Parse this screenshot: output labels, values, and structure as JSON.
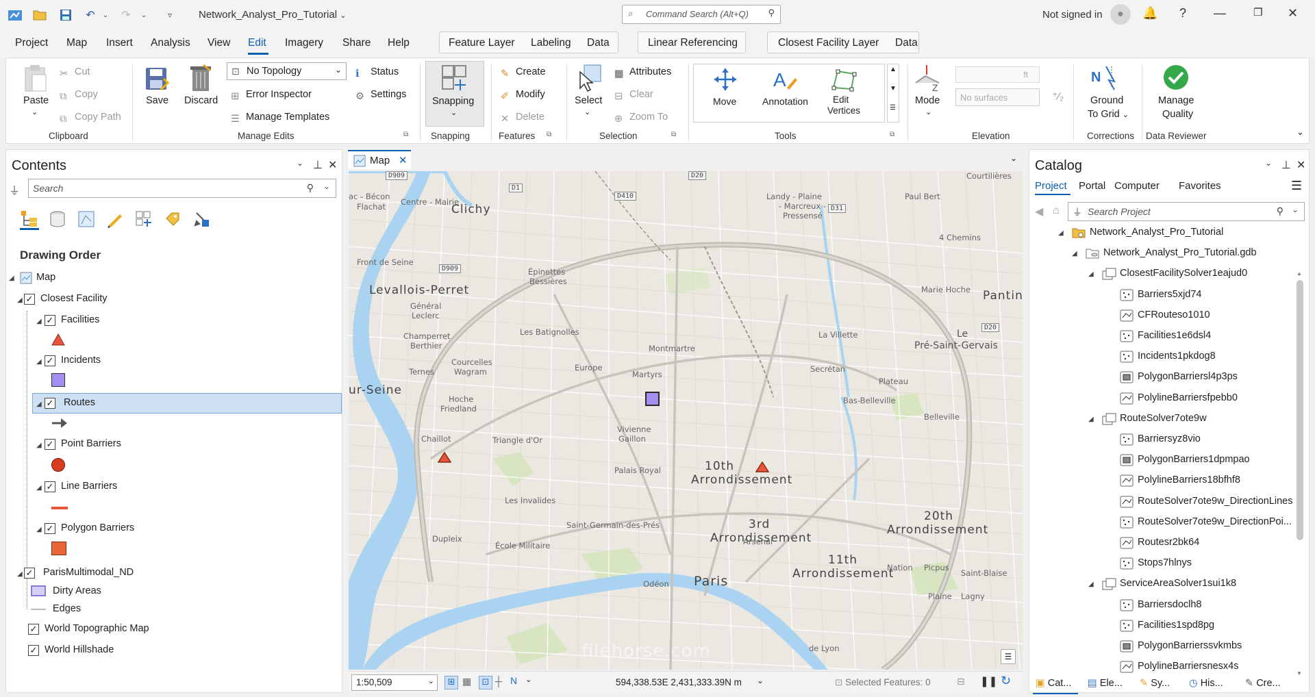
{
  "titlebar": {
    "project_name": "Network_Analyst_Pro_Tutorial",
    "command_search_placeholder": "Command Search (Alt+Q)",
    "signin": "Not signed in"
  },
  "menu": {
    "tabs": [
      "Project",
      "Map",
      "Insert",
      "Analysis",
      "View",
      "Edit",
      "Imagery",
      "Share",
      "Help"
    ],
    "active": "Edit",
    "context_tabs": {
      "feature_layer": [
        "Feature Layer",
        "Labeling",
        "Data"
      ],
      "linear_referencing": "Linear Referencing",
      "closest_facility": [
        "Closest Facility Layer",
        "Data"
      ]
    }
  },
  "ribbon": {
    "clipboard": {
      "paste": "Paste",
      "cut": "Cut",
      "copy": "Copy",
      "copy_path": "Copy Path",
      "label": "Clipboard"
    },
    "manage_edits": {
      "save": "Save",
      "discard": "Discard",
      "topology": "No Topology",
      "status": "Status",
      "error_inspector": "Error Inspector",
      "settings": "Settings",
      "manage_templates": "Manage Templates",
      "label": "Manage Edits"
    },
    "snapping": {
      "snapping": "Snapping",
      "label": "Snapping"
    },
    "features": {
      "create": "Create",
      "modify": "Modify",
      "delete": "Delete",
      "label": "Features"
    },
    "selection": {
      "select": "Select",
      "attributes": "Attributes",
      "clear": "Clear",
      "zoom_to": "Zoom To",
      "label": "Selection"
    },
    "tools": {
      "move": "Move",
      "annotation": "Annotation",
      "edit_vertices_1": "Edit",
      "edit_vertices_2": "Vertices",
      "label": "Tools"
    },
    "elevation": {
      "mode": "Mode",
      "unit": "ft",
      "no_surfaces": "No surfaces",
      "label": "Elevation"
    },
    "corrections": {
      "ground_1": "Ground",
      "ground_2": "To Grid",
      "label": "Corrections"
    },
    "data_reviewer": {
      "manage_1": "Manage",
      "manage_2": "Quality",
      "label": "Data Reviewer"
    }
  },
  "contents": {
    "title": "Contents",
    "search_placeholder": "Search",
    "heading": "Drawing Order",
    "map": "Map",
    "closest_facility": "Closest Facility",
    "facilities": "Facilities",
    "incidents": "Incidents",
    "routes": "Routes",
    "point_barriers": "Point Barriers",
    "line_barriers": "Line Barriers",
    "polygon_barriers": "Polygon Barriers",
    "paris_nd": "ParisMultimodal_ND",
    "dirty_areas": "Dirty Areas",
    "edges": "Edges",
    "world_topo": "World Topographic Map",
    "world_hillshade": "World Hillshade"
  },
  "map": {
    "tab": "Map",
    "scale": "1:50,509",
    "coords": "594,338.53E 2,431,333.39N m",
    "selected_features": "Selected Features: 0",
    "labels": {
      "clichy": "Clichy",
      "levallois": "Levallois-Perret",
      "paris": "Paris",
      "pantin": "Pantin",
      "le_pre": "Le",
      "le_pre2": "Pré-Saint-Gervais",
      "arr10a": "10th",
      "arr10b": "Arrondissement",
      "arr3a": "3rd",
      "arr3b": "Arrondissement",
      "arr11a": "11th",
      "arr11b": "Arrondissement",
      "arr20a": "20th",
      "arr20b": "Arrondissement",
      "seine": "ur-Seine",
      "front_seine": "Front de Seine",
      "centre_mairie": "Centre - Mairie",
      "bacon": "ac - Bécon",
      "flachat": "Flachat",
      "landy": "Landy - Plaine",
      "marcreux": "- Marcreux -",
      "pressense": "Pressensé",
      "paul_bert": "Paul Bert",
      "chemins": "4 Chemins",
      "courtilieres": "Courtilières",
      "general": "Général",
      "leclerc": "Leclerc",
      "marie_hoche": "Marie Hoche",
      "batignolles": "Les Batignolles",
      "europe": "Europe",
      "montmartre": "Montmartre",
      "martyrs": "Martyrs",
      "invalides": "Les Invalides",
      "st_germain": "Saint-Germain-des-Prés",
      "palais_royal": "Palais Royal",
      "ecole_mil": "École Militaire",
      "arsenal": "Arsenal",
      "belleville": "Belleville",
      "bas_belleville": "Bas-Belleville",
      "plateau": "Plateau",
      "la_villette": "La Villette",
      "secretan": "Secrétan",
      "nation": "Nation",
      "picpus": "Picpus",
      "odeon": "Odéon",
      "dupleix": "Dupleix",
      "vivienne": "Vivienne",
      "gaillon": "Gaillon",
      "chaillot": "Chaillot",
      "triangle": "Triangle d'Or",
      "hoche": "Hoche",
      "friedland": "Friedland",
      "champerret": "Champerret",
      "berthier": "Berthier",
      "ternes": "Ternes",
      "courcelles": "Courcelles",
      "wagram": "Wagram",
      "epinettes": "Épinettes",
      "bessieres": "Bessières",
      "plaine": "Plaine",
      "lagny": "Lagny",
      "gare_lyon": "de Lyon",
      "saint_blaise": "Saint-Blaise"
    },
    "shields": [
      "D909",
      "D1",
      "D410",
      "D20",
      "D31",
      "D909",
      "D20"
    ]
  },
  "catalog": {
    "title": "Catalog",
    "tabs": [
      "Project",
      "Portal",
      "Computer",
      "Favorites"
    ],
    "active_tab": "Project",
    "search_placeholder": "Search Project",
    "items": [
      {
        "label": "Network_Analyst_Pro_Tutorial",
        "level": 1,
        "kind": "folder"
      },
      {
        "label": "Network_Analyst_Pro_Tutorial.gdb",
        "level": 2,
        "kind": "gdb"
      },
      {
        "label": "ClosestFacilitySolver1eajud0",
        "level": 3,
        "kind": "dataset"
      },
      {
        "label": "Barriers5xjd74",
        "level": 4,
        "kind": "point"
      },
      {
        "label": "CFRouteso1010",
        "level": 4,
        "kind": "line"
      },
      {
        "label": "Facilities1e6dsl4",
        "level": 4,
        "kind": "point"
      },
      {
        "label": "Incidents1pkdog8",
        "level": 4,
        "kind": "point"
      },
      {
        "label": "PolygonBarriersl4p3ps",
        "level": 4,
        "kind": "polygon"
      },
      {
        "label": "PolylineBarriersfpebb0",
        "level": 4,
        "kind": "line"
      },
      {
        "label": "RouteSolver7ote9w",
        "level": 3,
        "kind": "dataset"
      },
      {
        "label": "Barriersyz8vio",
        "level": 4,
        "kind": "point"
      },
      {
        "label": "PolygonBarriers1dpmpao",
        "level": 4,
        "kind": "polygon"
      },
      {
        "label": "PolylineBarriers18bfhf8",
        "level": 4,
        "kind": "line"
      },
      {
        "label": "RouteSolver7ote9w_DirectionLines",
        "level": 4,
        "kind": "line"
      },
      {
        "label": "RouteSolver7ote9w_DirectionPoi...",
        "level": 4,
        "kind": "point"
      },
      {
        "label": "Routesr2bk64",
        "level": 4,
        "kind": "line"
      },
      {
        "label": "Stops7hlnys",
        "level": 4,
        "kind": "point"
      },
      {
        "label": "ServiceAreaSolver1sui1k8",
        "level": 3,
        "kind": "dataset"
      },
      {
        "label": "Barriersdoclh8",
        "level": 4,
        "kind": "point"
      },
      {
        "label": "Facilities1spd8pg",
        "level": 4,
        "kind": "point"
      },
      {
        "label": "PolygonBarrierssvkmbs",
        "level": 4,
        "kind": "polygon"
      },
      {
        "label": "PolylineBarriersnesx4s",
        "level": 4,
        "kind": "line"
      }
    ]
  },
  "bottom_tabs": [
    "Cat...",
    "Ele...",
    "Sy...",
    "His...",
    "Cre..."
  ],
  "colors": {
    "accent": "#0b5fb0",
    "incident": "#a38ef2",
    "facility": "#e8553a",
    "barrier": "#d83b1f",
    "selection": "#cde0f3"
  },
  "watermark": "filehorse.com"
}
